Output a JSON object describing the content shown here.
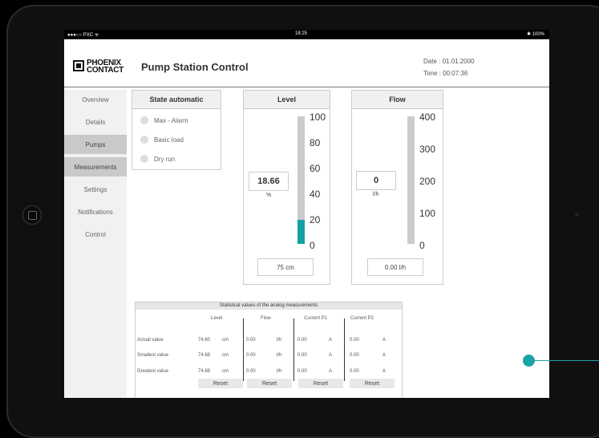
{
  "statusbar": {
    "carrier": "●●●○○ PXC  ᯤ",
    "time": "18:25",
    "battery": "✱ 100%"
  },
  "header": {
    "logo_line1": "PHOENIX",
    "logo_line2": "CONTACT",
    "title": "Pump Station Control",
    "date": "Date :  01.01.2000",
    "time": "Time :  00:07:36"
  },
  "nav": [
    "Overview",
    "Details",
    "Pumps",
    "Measurements",
    "Settings",
    "Notifications",
    "Control"
  ],
  "state_panel": {
    "title": "State automatic",
    "items": [
      "Max - Alarm",
      "Basic load",
      "Dry run"
    ]
  },
  "level_panel": {
    "title": "Level",
    "value": "18.66",
    "unit": "%",
    "ticks": [
      "100",
      "80",
      "60",
      "40",
      "20",
      "0"
    ],
    "fill_percent": 18.66,
    "readout": "75   cm"
  },
  "flow_panel": {
    "title": "Flow",
    "value": "0",
    "unit": "l/h",
    "ticks": [
      "400",
      "300",
      "200",
      "100",
      "0"
    ],
    "fill_percent": 0,
    "readout": "0.00 l/h"
  },
  "stats": {
    "title": "Statistical values of the analog measurements",
    "columns": [
      "Level",
      "Flow",
      "Current P1",
      "Current P2"
    ],
    "rows": [
      {
        "label": "Actual value",
        "cells": [
          "74.60",
          "cm",
          "0.00",
          "l/h",
          "0.00",
          "A",
          "0.00",
          "A"
        ]
      },
      {
        "label": "Smallest value",
        "cells": [
          "74.68",
          "cm",
          "0.00",
          "l/h",
          "0.00",
          "A",
          "0.00",
          "A"
        ]
      },
      {
        "label": "Greatest value",
        "cells": [
          "74.88",
          "cm",
          "0.00",
          "l/h",
          "0.00",
          "A",
          "0.00",
          "A"
        ]
      }
    ],
    "reset_labels": [
      "Reset",
      "Reset",
      "Reset",
      "Reset"
    ]
  },
  "colors": {
    "accent": "#14a0a2",
    "bar_track": "#cccccc",
    "nav_active": "#c9c9c9"
  }
}
